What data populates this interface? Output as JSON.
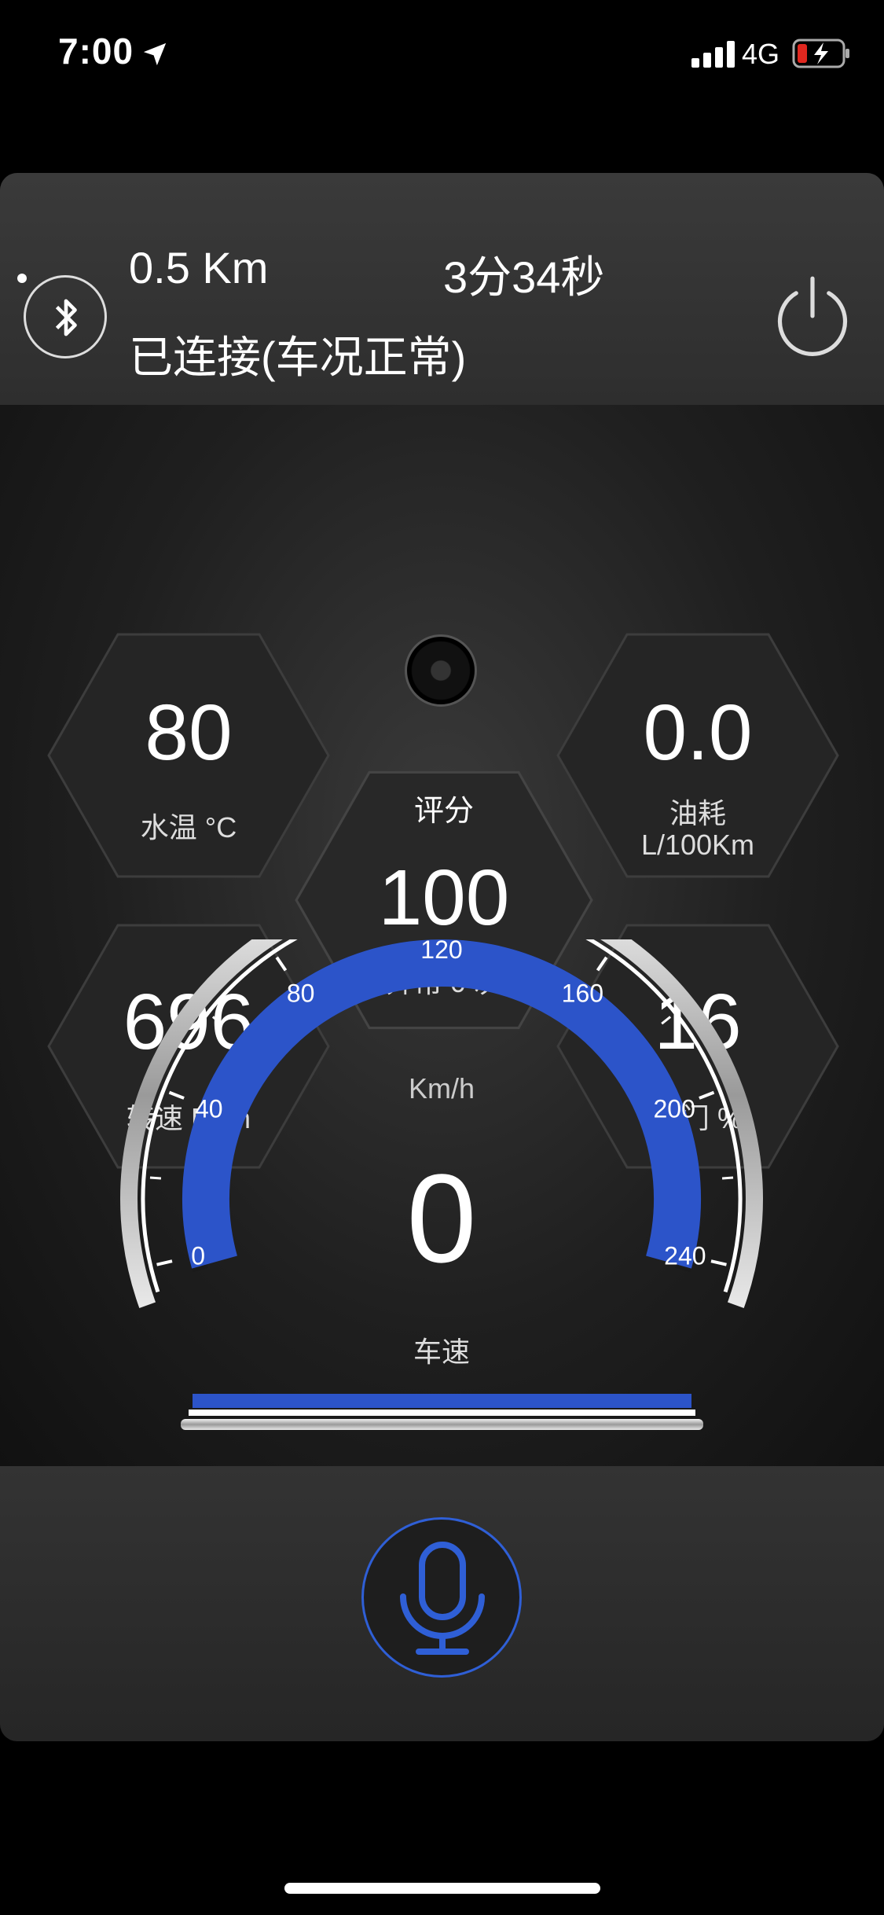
{
  "status_bar": {
    "time": "7:00",
    "network": "4G",
    "icons": [
      "location-arrow-icon",
      "signal-bars-icon",
      "battery-charging-icon"
    ]
  },
  "trip": {
    "distance": "0.5 Km",
    "duration": "3分34秒",
    "connection_status": "已连接(车况正常)"
  },
  "metrics": {
    "water_temp": {
      "value": "80",
      "label": "水温 °C"
    },
    "fuel": {
      "value": "0.0",
      "label_line1": "油耗",
      "label_line2": "L/100Km"
    },
    "score": {
      "title": "评分",
      "value": "100",
      "anomaly": "异常 0 次"
    },
    "rpm": {
      "value": "696",
      "label": "转速 Rpm"
    },
    "throttle": {
      "value": "16",
      "label": "油门 %"
    }
  },
  "speedometer": {
    "unit": "Km/h",
    "speed": "0",
    "label": "车速",
    "ticks": [
      "0",
      "40",
      "80",
      "120",
      "160",
      "200",
      "240"
    ],
    "min": 0,
    "max": 240,
    "value": 0
  },
  "colors": {
    "accent": "#2f5fd6",
    "arc": "#2c54c9"
  },
  "icons": {
    "bluetooth": "bluetooth-icon",
    "power": "power-icon",
    "mic": "microphone-icon",
    "camera": "camera-lens-icon"
  }
}
